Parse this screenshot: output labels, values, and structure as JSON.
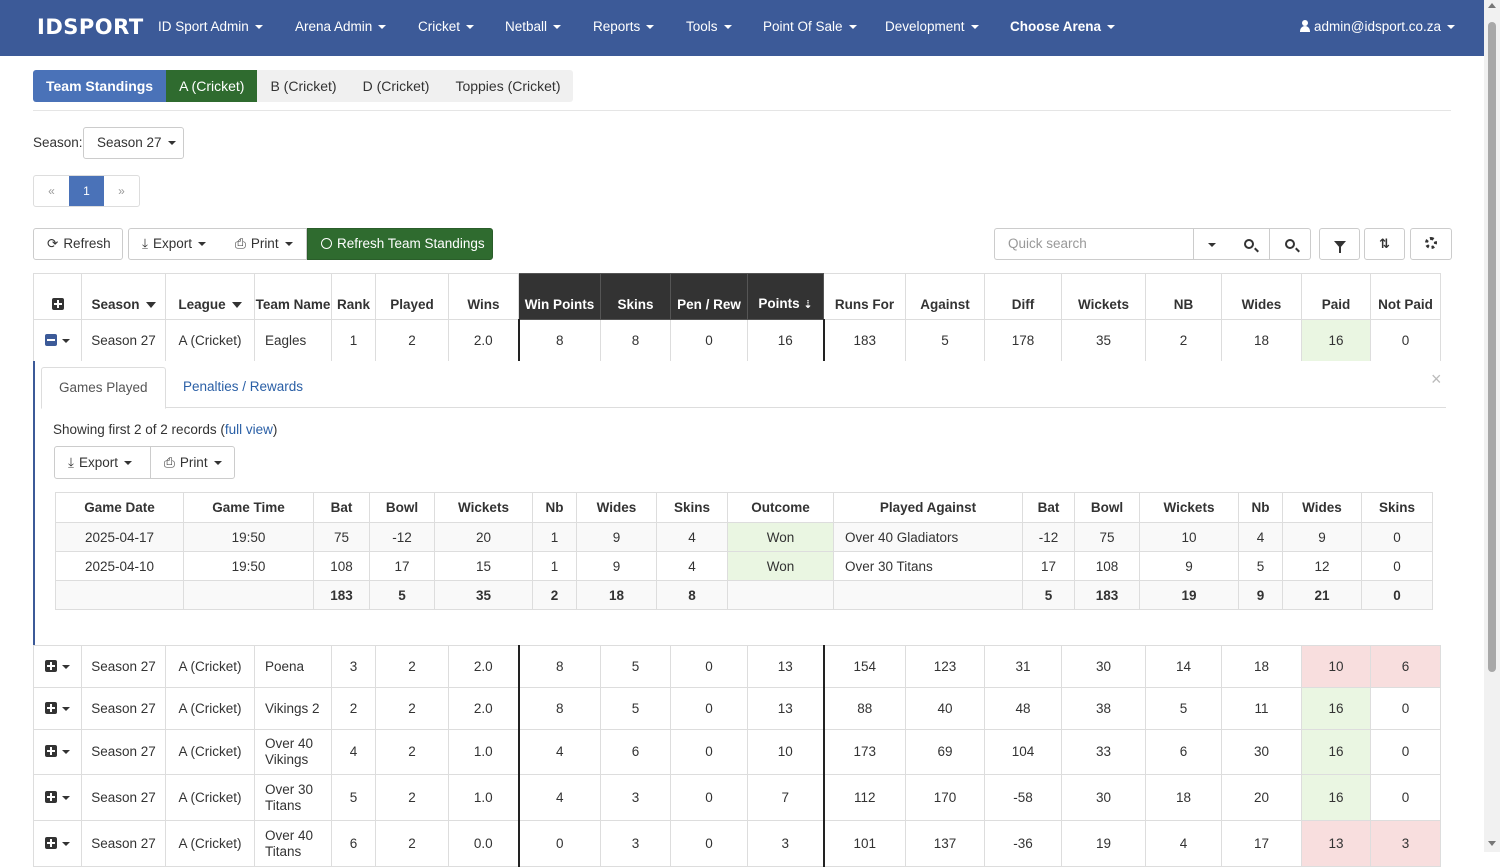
{
  "nav": {
    "brand": "IDSPORT",
    "items": [
      "ID Sport Admin",
      "Arena Admin",
      "Cricket",
      "Netball",
      "Reports",
      "Tools",
      "Point Of Sale",
      "Development"
    ],
    "choose_arena": "Choose Arena",
    "user": "admin@idsport.co.za"
  },
  "pills": [
    "Team Standings",
    "A (Cricket)",
    "B (Cricket)",
    "D (Cricket)",
    "Toppies (Cricket)"
  ],
  "season": {
    "label": "Season:",
    "value": "Season 27"
  },
  "pager": {
    "prev": "«",
    "current": "1",
    "next": "»"
  },
  "toolbar": {
    "refresh": "Refresh",
    "export": "Export",
    "print": "Print",
    "refresh_standings": "Refresh Team Standings",
    "search_placeholder": "Quick search"
  },
  "table": {
    "headers": {
      "season": "Season",
      "league": "League",
      "team_name": "Team Name",
      "rank": "Rank",
      "played": "Played",
      "wins": "Wins",
      "win_points": "Win Points",
      "skins": "Skins",
      "pen_rew": "Pen / Rew",
      "points": "Points",
      "runs_for": "Runs For",
      "against": "Against",
      "diff": "Diff",
      "wickets": "Wickets",
      "nb": "NB",
      "wides": "Wides",
      "paid": "Paid",
      "not_paid": "Not Paid"
    },
    "expanded_row": [
      "Season 27",
      "A (Cricket)",
      "Eagles",
      "1",
      "2",
      "2.0",
      "8",
      "8",
      "0",
      "16",
      "183",
      "5",
      "178",
      "35",
      "2",
      "18",
      "16",
      "0"
    ],
    "rows": [
      [
        "Season 27",
        "A (Cricket)",
        "Poena",
        "3",
        "2",
        "2.0",
        "8",
        "5",
        "0",
        "13",
        "154",
        "123",
        "31",
        "30",
        "14",
        "18",
        "10",
        "6"
      ],
      [
        "Season 27",
        "A (Cricket)",
        "Vikings 2",
        "2",
        "2",
        "2.0",
        "8",
        "5",
        "0",
        "13",
        "88",
        "40",
        "48",
        "38",
        "5",
        "11",
        "16",
        "0"
      ],
      [
        "Season 27",
        "A (Cricket)",
        "Over 40 Vikings",
        "4",
        "2",
        "1.0",
        "4",
        "6",
        "0",
        "10",
        "173",
        "69",
        "104",
        "33",
        "6",
        "30",
        "16",
        "0"
      ],
      [
        "Season 27",
        "A (Cricket)",
        "Over 30 Titans",
        "5",
        "2",
        "1.0",
        "4",
        "3",
        "0",
        "7",
        "112",
        "170",
        "-58",
        "30",
        "18",
        "20",
        "16",
        "0"
      ],
      [
        "Season 27",
        "A (Cricket)",
        "Over 40 Titans",
        "6",
        "2",
        "0.0",
        "0",
        "3",
        "0",
        "3",
        "101",
        "137",
        "-36",
        "19",
        "4",
        "17",
        "13",
        "3"
      ]
    ]
  },
  "detail": {
    "tab_games": "Games Played",
    "tab_penalties": "Penalties / Rewards",
    "close": "×",
    "showing_text": "Showing first 2 of 2 records (",
    "full_view": "full view",
    "showing_close": ")",
    "export": "Export",
    "print": "Print",
    "headers": [
      "Game Date",
      "Game Time",
      "Bat",
      "Bowl",
      "Wickets",
      "Nb",
      "Wides",
      "Skins",
      "Outcome",
      "Played Against",
      "Bat",
      "Bowl",
      "Wickets",
      "Nb",
      "Wides",
      "Skins"
    ],
    "games": [
      [
        "2025-04-17",
        "19:50",
        "75",
        "-12",
        "20",
        "1",
        "9",
        "4",
        "Won",
        "Over 40 Gladiators",
        "-12",
        "75",
        "10",
        "4",
        "9",
        "0"
      ],
      [
        "2025-04-10",
        "19:50",
        "108",
        "17",
        "15",
        "1",
        "9",
        "4",
        "Won",
        "Over 30 Titans",
        "17",
        "108",
        "9",
        "5",
        "12",
        "0"
      ]
    ],
    "totals": [
      "",
      "",
      "183",
      "5",
      "35",
      "2",
      "18",
      "8",
      "",
      "",
      "5",
      "183",
      "19",
      "9",
      "21",
      "0"
    ]
  }
}
